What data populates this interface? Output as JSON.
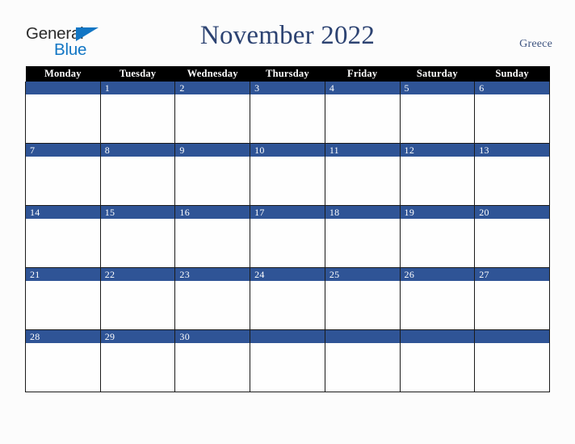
{
  "logo": {
    "word_one": "General",
    "word_two": "Blue",
    "triangle_icon": "blue-triangle-icon",
    "color_dark": "#2c2c2c",
    "color_blue": "#1276c4"
  },
  "header": {
    "title": "November 2022",
    "country": "Greece",
    "title_color": "#2d4372"
  },
  "calendar": {
    "weekday_headers": [
      "Monday",
      "Tuesday",
      "Wednesday",
      "Thursday",
      "Friday",
      "Saturday",
      "Sunday"
    ],
    "header_bg": "#000000",
    "header_text": "#ffffff",
    "daynum_band_bg": "#2f5496",
    "daynum_text": "#ffffff",
    "weeks": [
      [
        "",
        "1",
        "2",
        "3",
        "4",
        "5",
        "6"
      ],
      [
        "7",
        "8",
        "9",
        "10",
        "11",
        "12",
        "13"
      ],
      [
        "14",
        "15",
        "16",
        "17",
        "18",
        "19",
        "20"
      ],
      [
        "21",
        "22",
        "23",
        "24",
        "25",
        "26",
        "27"
      ],
      [
        "28",
        "29",
        "30",
        "",
        "",
        "",
        ""
      ]
    ]
  }
}
